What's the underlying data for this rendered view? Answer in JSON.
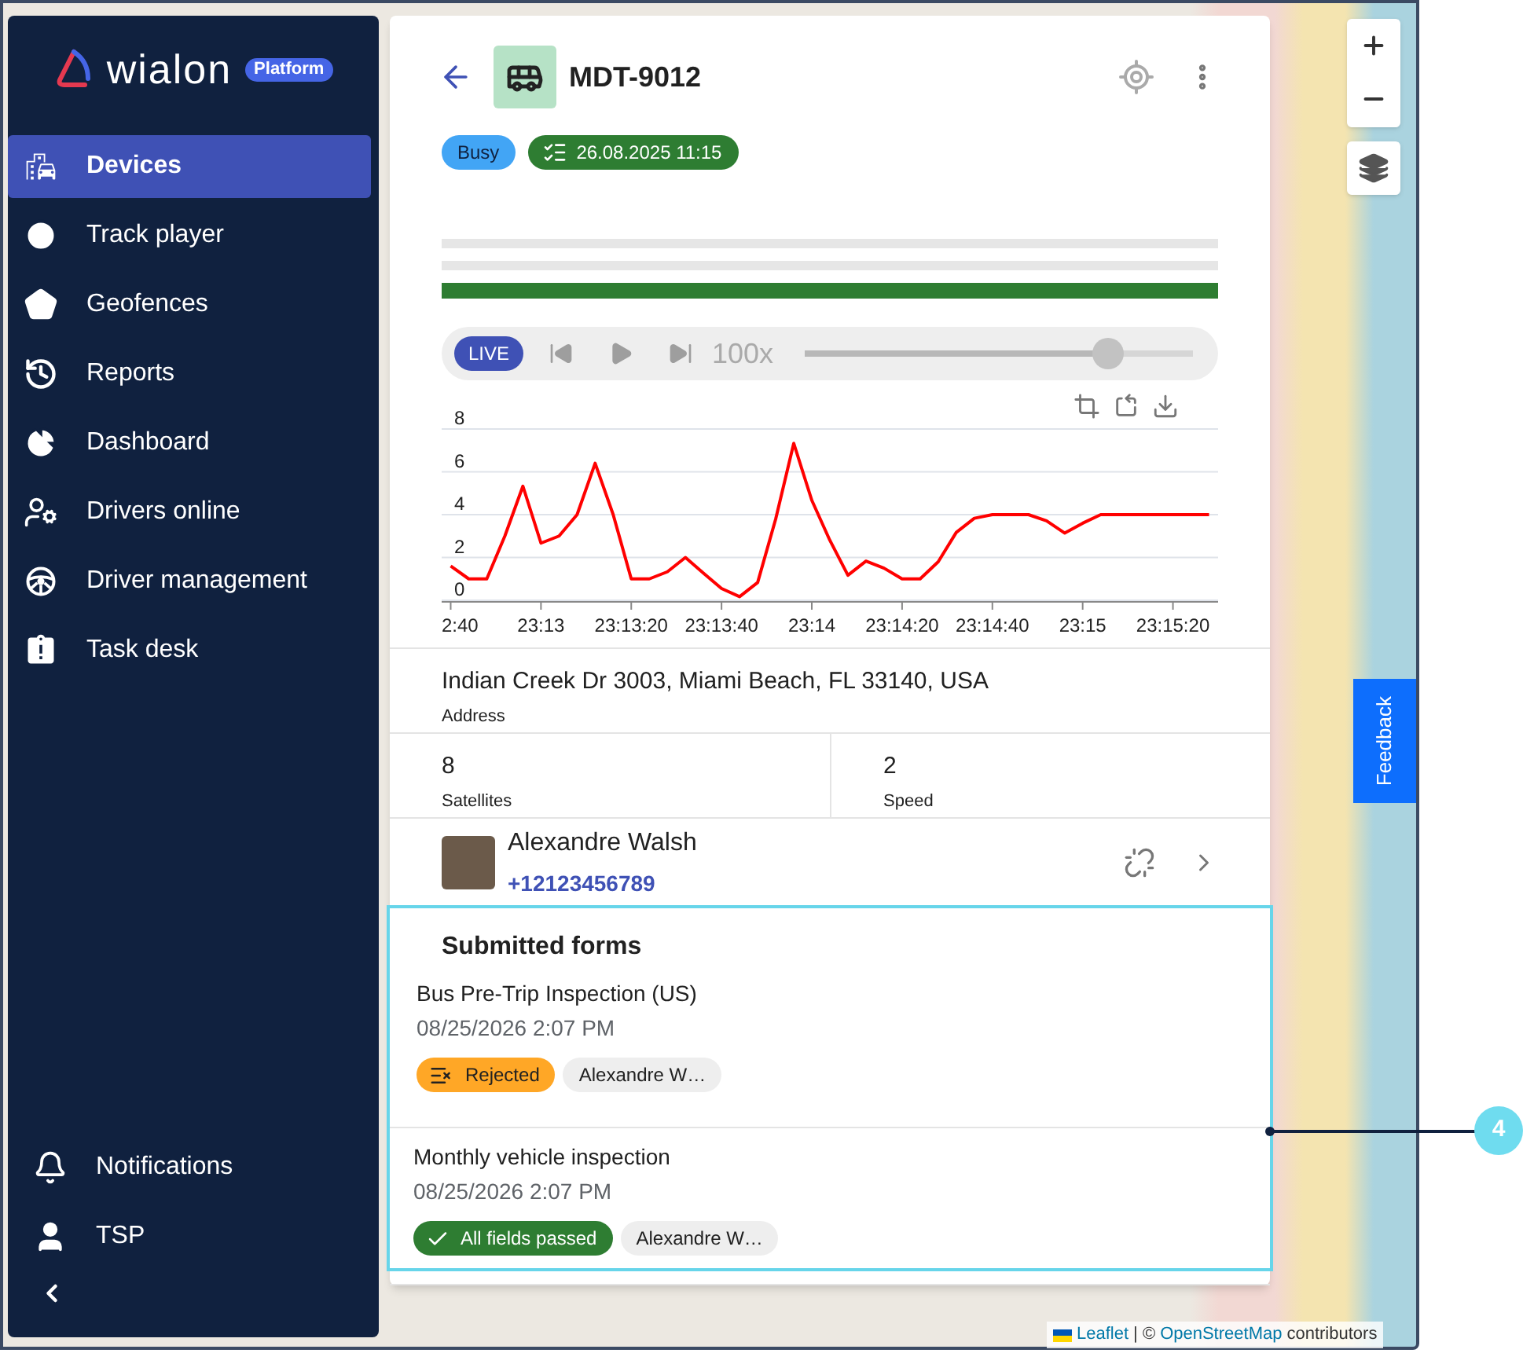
{
  "logo": {
    "text": "wialon",
    "badge": "Platform"
  },
  "sidebar": {
    "items": [
      {
        "label": "Devices",
        "selected": true
      },
      {
        "label": "Track player",
        "selected": false
      },
      {
        "label": "Geofences",
        "selected": false
      },
      {
        "label": "Reports",
        "selected": false
      },
      {
        "label": "Dashboard",
        "selected": false
      },
      {
        "label": "Drivers online",
        "selected": false
      },
      {
        "label": "Driver management",
        "selected": false
      },
      {
        "label": "Task desk",
        "selected": false
      }
    ],
    "bottom_items": [
      {
        "label": "Notifications",
        "selected": false
      },
      {
        "label": "TSP",
        "selected": false
      }
    ]
  },
  "device": {
    "title": "MDT-9012",
    "chips": [
      {
        "kind": "status",
        "label": "Busy"
      },
      {
        "kind": "task",
        "label": "26.08.2025 11:15"
      }
    ]
  },
  "player": {
    "live": "LIVE",
    "speed": "100x",
    "level": 0.78
  },
  "chart": {
    "chart_data": {
      "type": "line",
      "categories": [
        "2:40",
        null,
        null,
        null,
        null,
        "23:13",
        null,
        null,
        null,
        null,
        "23:13:20",
        null,
        null,
        null,
        null,
        "23:13:40",
        null,
        null,
        null,
        null,
        "23:14",
        null,
        null,
        null,
        null,
        "23:14:20",
        null,
        null,
        null,
        null,
        "23:14:40",
        null,
        null,
        null,
        null,
        "23:15",
        null,
        null,
        null,
        null,
        "23:15:20",
        null,
        null
      ],
      "series": [
        {
          "color": "#ff0000",
          "values": [
            1.6,
            1,
            1,
            3,
            5.33,
            2.67,
            3,
            4,
            6.4,
            4,
            1,
            1,
            1.33,
            2,
            1.27,
            0.55,
            0.17,
            0.83,
            3.8,
            7.33,
            4.67,
            2.8,
            1.17,
            1.83,
            1.5,
            1,
            1,
            1.8,
            3.17,
            3.83,
            4,
            4,
            4,
            3.71,
            3.14,
            3.6,
            4,
            4,
            4,
            4,
            4,
            4,
            4
          ]
        }
      ],
      "ylim": [
        0,
        8
      ],
      "grid": true,
      "yticks": [
        0,
        2,
        4,
        6,
        8
      ]
    }
  },
  "address": {
    "value": "Indian Creek Dr 3003, Miami Beach, FL 33140, USA",
    "label": "Address"
  },
  "stats": [
    {
      "value": "8",
      "label": "Satellites"
    },
    {
      "value": "2",
      "label": "Speed"
    }
  ],
  "driver": {
    "name": "Alexandre Walsh",
    "phone": "+12123456789"
  },
  "submitted_forms": {
    "title": "Submitted forms",
    "highlighted": true,
    "forms": [
      {
        "title": "Bus Pre-Trip Inspection (US)",
        "date": "08/25/2026 2:07 PM",
        "result": {
          "kind": "rejected",
          "label": "Rejected"
        },
        "driver": "Alexandre W…"
      },
      {
        "title": "Monthly vehicle inspection",
        "date": "08/25/2026 2:07 PM",
        "result": {
          "kind": "passed",
          "label": "All fields passed"
        },
        "driver": "Alexandre W…"
      }
    ]
  },
  "feedback_button": {
    "label": "Feedback"
  },
  "attribution": {
    "link": "Leaflet",
    "separator": "| ©",
    "source": "OpenStreetMap",
    "suffix": "contributors"
  },
  "callout": {
    "label": "4"
  }
}
